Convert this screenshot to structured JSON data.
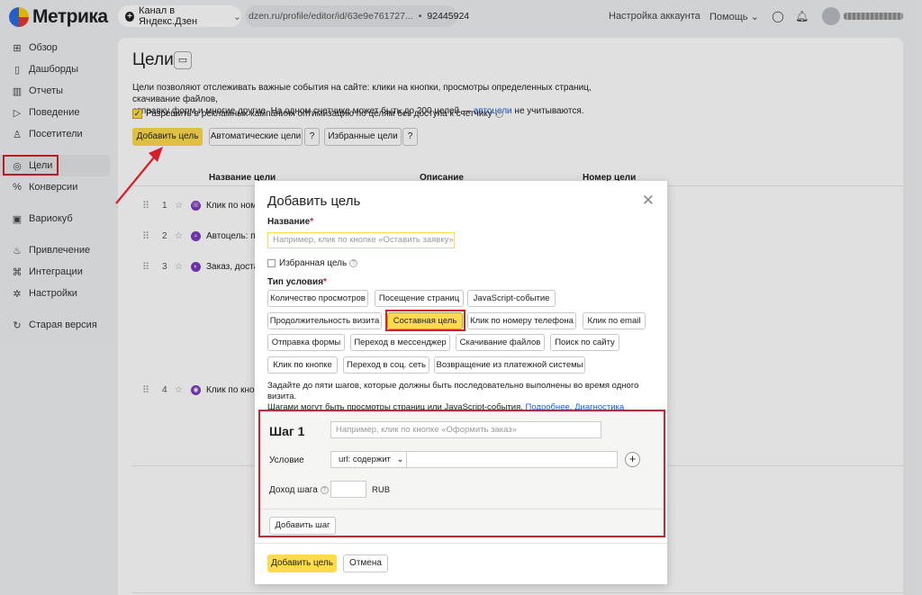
{
  "topbar": {
    "logo": "Метрика",
    "counter_name": "Канал в Яндекс.Дзен",
    "counter_url": "dzen.ru/profile/editor/id/63e9e761727...",
    "counter_id": "92445924",
    "account_settings": "Настройка аккаунта",
    "help": "Помощь"
  },
  "sidebar": {
    "items": [
      {
        "label": "Обзор",
        "icon": "grid-icon"
      },
      {
        "label": "Дашборды",
        "icon": "dashboard-icon"
      },
      {
        "label": "Отчеты",
        "icon": "bar-chart-icon"
      },
      {
        "label": "Поведение",
        "icon": "play-icon"
      },
      {
        "label": "Посетители",
        "icon": "user-icon"
      },
      {
        "label": "Цели",
        "icon": "target-icon"
      },
      {
        "label": "Конверсии",
        "icon": "percent-icon"
      },
      {
        "label": "Вариокуб",
        "icon": "cube-icon"
      },
      {
        "label": "Привлечение",
        "icon": "flame-icon"
      },
      {
        "label": "Интеграции",
        "icon": "puzzle-icon"
      },
      {
        "label": "Настройки",
        "icon": "gear-icon"
      },
      {
        "label": "Старая версия",
        "icon": "refresh-icon"
      }
    ]
  },
  "page": {
    "title": "Цели",
    "desc_1": "Цели позволяют отслеживать важные события на сайте: клики на кнопки, просмотры определенных страниц, скачивание файлов,",
    "desc_2": "отправку форм и многие другие. На одном счетчике может быть до 200 целей — ",
    "desc_link": "автоцели",
    "desc_3": " не учитываются.",
    "allow_checkbox": "Разрешить в рекламных кампаниях оптимизацию по целям без доступа к счетчику",
    "add_goal": "Добавить цель",
    "auto_goals": "Автоматические цели",
    "fav_goals": "Избранные цели"
  },
  "table": {
    "headers": [
      "Название цели",
      "Описание",
      "Номер цели"
    ],
    "rows": [
      {
        "num": "1",
        "name": "Клик по номе"
      },
      {
        "num": "2",
        "name": "Автоцель: по"
      },
      {
        "num": "3",
        "name": "Заказ, достав"
      },
      {
        "num": "4",
        "name": "Клик по кнопк"
      }
    ]
  },
  "modal": {
    "title": "Добавить цель",
    "name_label": "Название",
    "name_placeholder": "Например, клик по кнопке «Оставить заявку»",
    "favorite_label": "Избранная цель",
    "condition_type_label": "Тип условия",
    "types": [
      "Количество просмотров",
      "Посещение страниц",
      "JavaScript-событие",
      "Продолжительность визита",
      "Составная цель",
      "Клик по номеру телефона",
      "Клик по email",
      "Отправка формы",
      "Переход в мессенджер",
      "Скачивание файлов",
      "Поиск по сайту",
      "Клик по кнопке",
      "Переход в соц. сеть",
      "Возвращение из платежной системы"
    ],
    "selected_type": "Составная цель",
    "hint_1": "Задайте до пяти шагов, которые должны быть последовательно выполнены во время одного визита.",
    "hint_2": "Шагами могут быть просмотры страниц или JavaScript-события. ",
    "hint_more": "Подробнее",
    "hint_diag": "Диагностика проблем",
    "step": {
      "title": "Шаг 1",
      "placeholder": "Например, клик по кнопке «Оформить заказ»",
      "condition_label": "Условие",
      "condition_value": "url: содержит",
      "revenue_label": "Доход шага",
      "currency": "RUB",
      "add_step": "Добавить шаг"
    },
    "submit": "Добавить цель",
    "cancel": "Отмена"
  }
}
